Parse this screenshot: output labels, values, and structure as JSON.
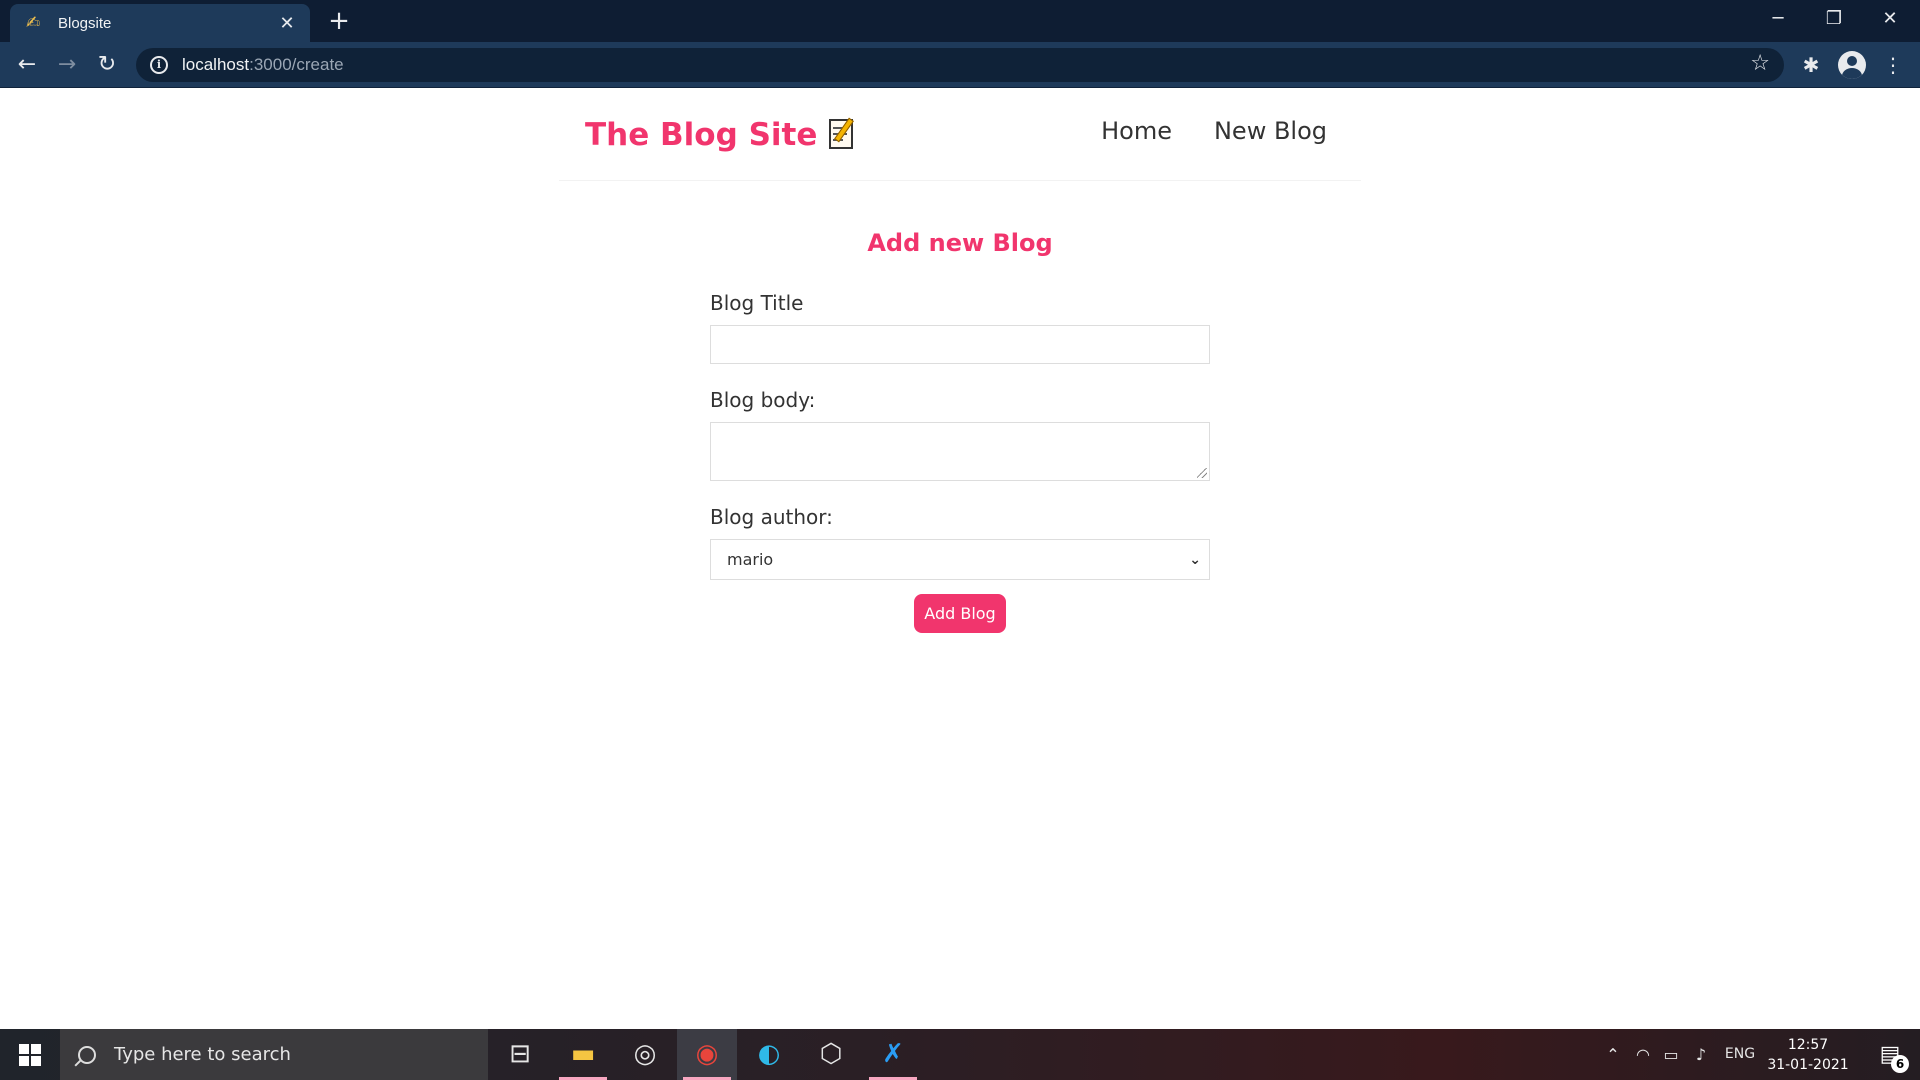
{
  "browser": {
    "tab_title": "Blogsite",
    "new_tab": "+",
    "url_host": "localhost",
    "url_path": ":3000/create"
  },
  "icons": {
    "tab_favicon": "✍",
    "tab_close": "✕",
    "back": "←",
    "forward": "→",
    "reload": "↻",
    "star": "☆",
    "extensions": "✱",
    "menu": "⋮",
    "minimize": "─",
    "restore": "❐",
    "close": "✕"
  },
  "site": {
    "brand": "The Blog Site",
    "nav": [
      "Home",
      "New Blog"
    ]
  },
  "form": {
    "heading": "Add new Blog",
    "title_label": "Blog Title",
    "title_value": "",
    "body_label": "Blog body:",
    "body_value": "",
    "author_label": "Blog author:",
    "author_selected": "mario",
    "submit_label": "Add Blog"
  },
  "taskbar": {
    "search_placeholder": "Type here to search",
    "language": "ENG",
    "time": "12:57",
    "date": "31-01-2021",
    "notification_count": "6"
  },
  "colors": {
    "brand": "#f1356d",
    "chrome_dark": "#0e1d33",
    "chrome_toolbar": "#1e3a5a"
  }
}
